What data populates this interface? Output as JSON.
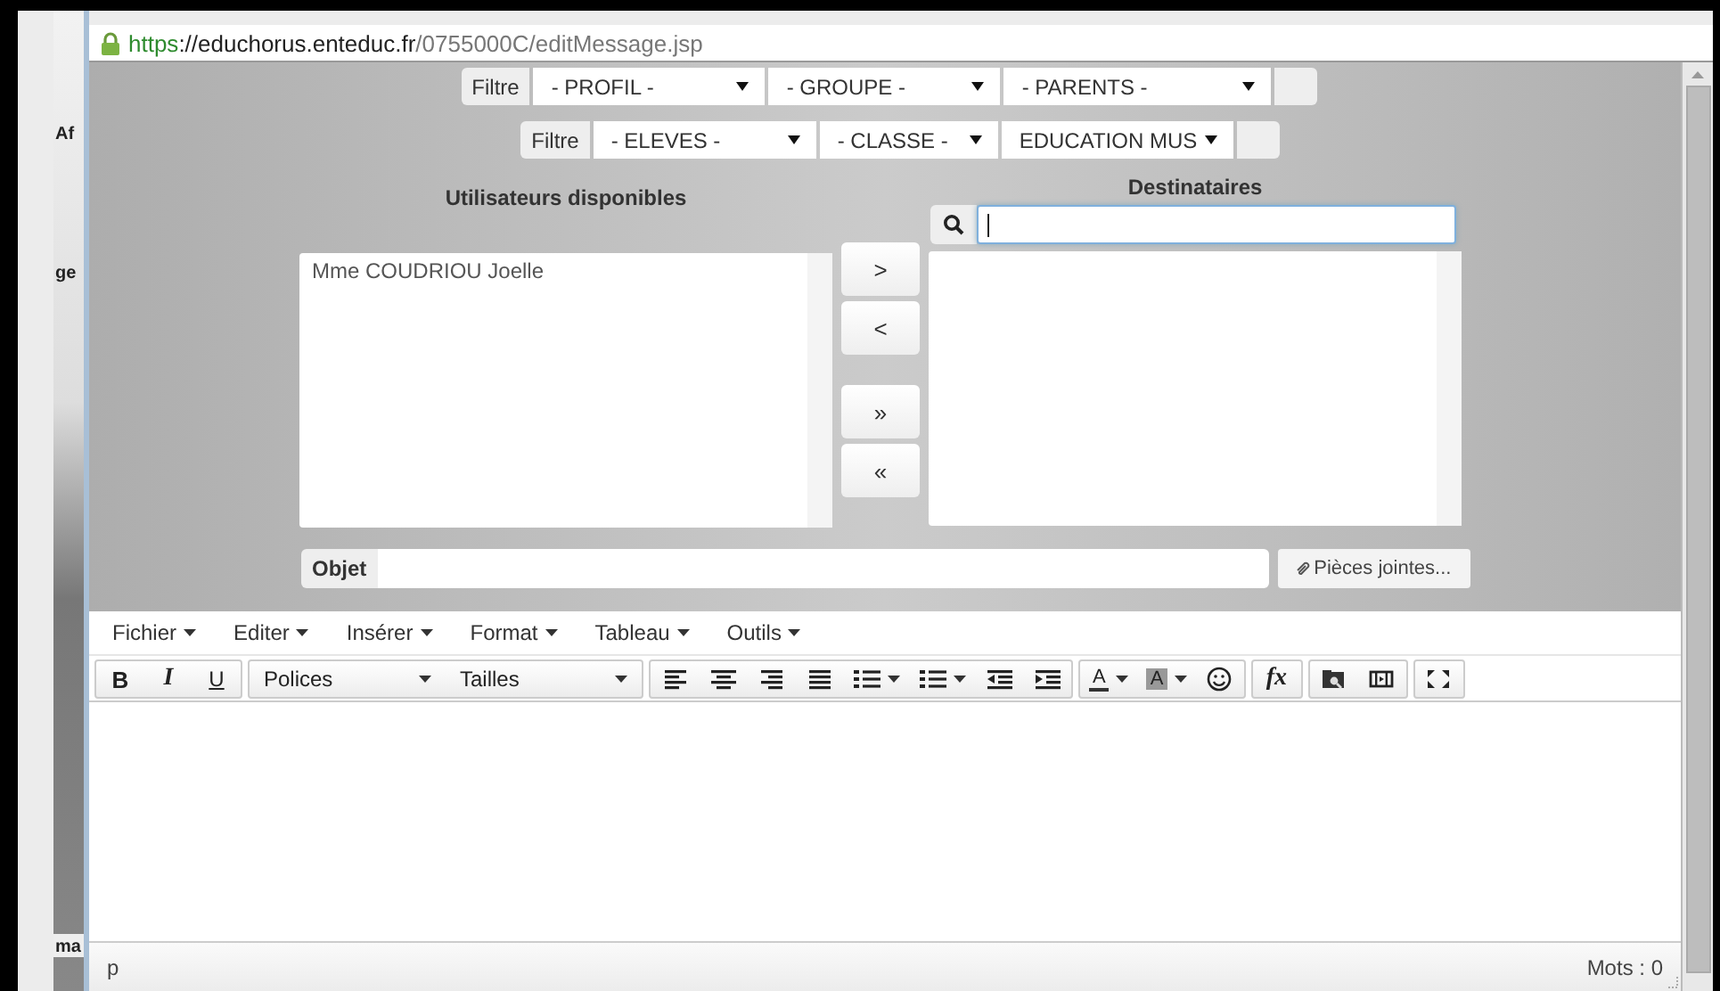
{
  "background_window": {
    "fragments": [
      "Af",
      "ge",
      "ma"
    ]
  },
  "address_bar": {
    "url": [
      {
        "kind": "scheme",
        "text": "https"
      },
      {
        "kind": "host",
        "text": "://educhorus.enteduc.fr"
      },
      {
        "kind": "path",
        "text": "/0755000C/editMessage.jsp"
      }
    ]
  },
  "filters": [
    {
      "label": "Filtre",
      "selects": [
        "- PROFIL -",
        "- GROUPE -",
        "- PARENTS -"
      ]
    },
    {
      "label": "Filtre",
      "selects": [
        "- ELEVES -",
        "- CLASSE -",
        "EDUCATION MUS"
      ]
    }
  ],
  "available": {
    "title": "Utilisateurs disponibles",
    "items": [
      "Mme COUDRIOU Joelle"
    ]
  },
  "recipients": {
    "title": "Destinataires"
  },
  "transfer_buttons": [
    ">",
    "<",
    "»",
    "«"
  ],
  "subject": {
    "label": "Objet"
  },
  "attachments_button": "Pièces jointes...",
  "editor": {
    "menus": [
      "Fichier",
      "Editer",
      "Insérer",
      "Format",
      "Tableau",
      "Outils"
    ],
    "toolbar": [
      [
        {
          "kind": "bold",
          "label": "B"
        },
        {
          "kind": "italic",
          "label": "I"
        },
        {
          "kind": "underline",
          "label": "U"
        }
      ],
      [
        {
          "kind": "select",
          "label": "Polices"
        },
        {
          "kind": "select",
          "label": "Tailles"
        }
      ],
      [
        {
          "kind": "align_left"
        },
        {
          "kind": "align_center"
        },
        {
          "kind": "align_right"
        },
        {
          "kind": "justify"
        },
        {
          "kind": "bullets"
        },
        {
          "kind": "numbers"
        },
        {
          "kind": "outdent"
        },
        {
          "kind": "indent"
        }
      ],
      [
        {
          "kind": "text_color",
          "label": "A"
        },
        {
          "kind": "bg_color",
          "label": "A"
        },
        {
          "kind": "emoji"
        }
      ],
      [
        {
          "kind": "formula",
          "label": "fx"
        }
      ],
      [
        {
          "kind": "image"
        },
        {
          "kind": "media"
        }
      ],
      [
        {
          "kind": "fullscreen"
        }
      ]
    ],
    "status_path": "p",
    "word_count": "Mots : 0"
  }
}
